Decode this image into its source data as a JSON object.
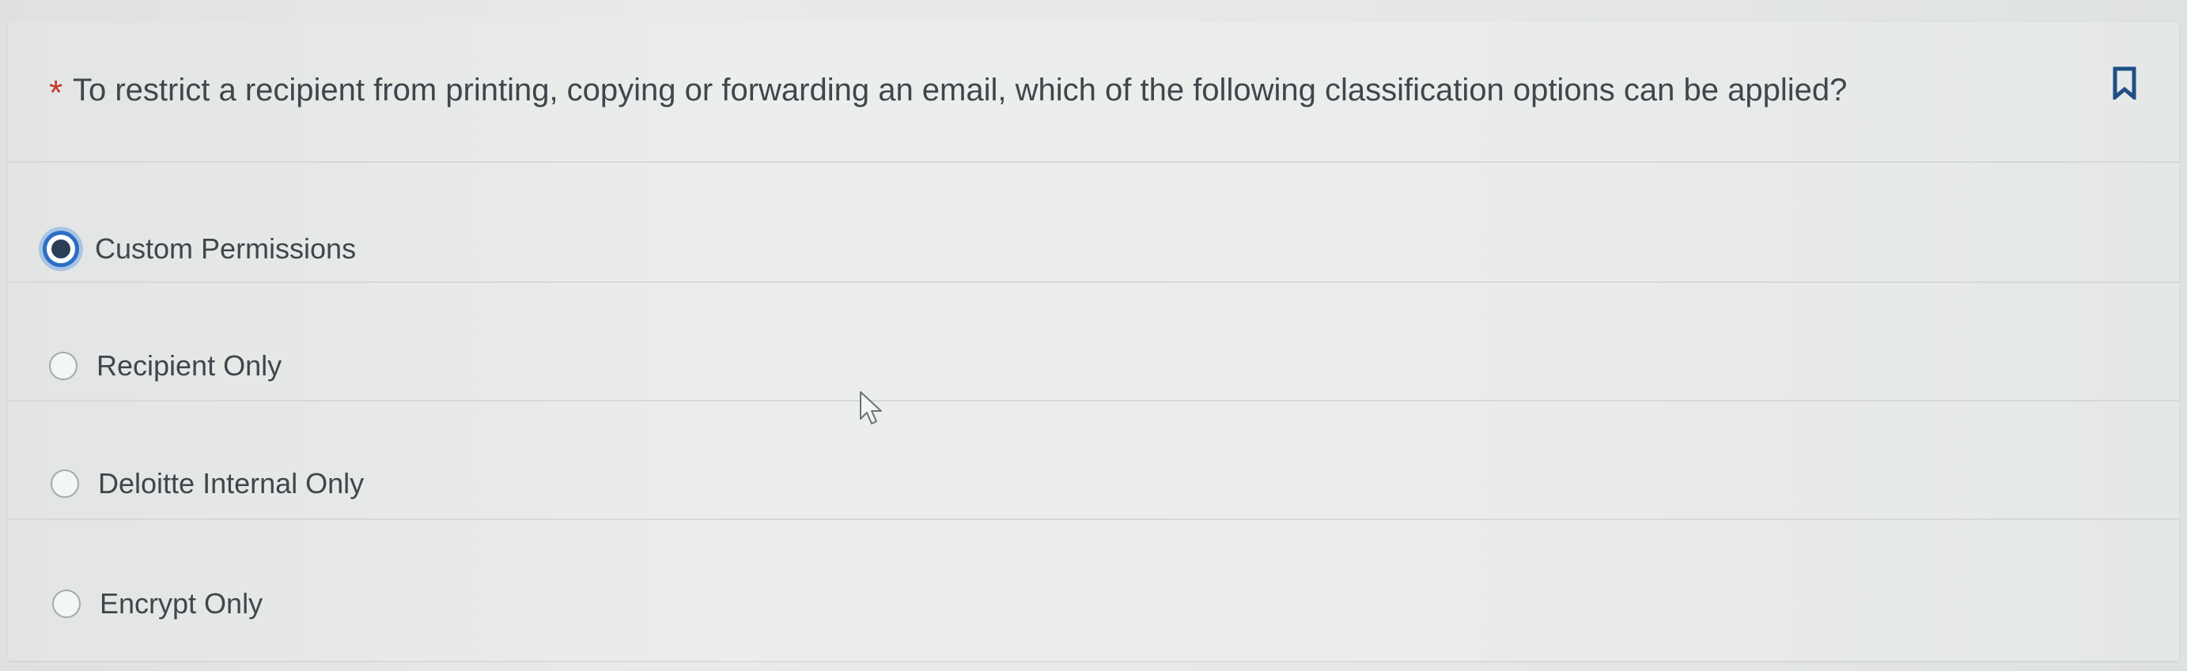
{
  "question": {
    "required_marker": "*",
    "text": "To restrict a recipient from printing, copying or forwarding an email, which of the following classification options can be applied?",
    "bookmark_icon": "bookmark-icon"
  },
  "options": [
    {
      "label": "Custom Permissions",
      "selected": true
    },
    {
      "label": "Recipient Only",
      "selected": false
    },
    {
      "label": "Deloitte Internal Only",
      "selected": false
    },
    {
      "label": "Encrypt Only",
      "selected": false
    }
  ],
  "colors": {
    "required": "#c0392b",
    "radio_selected": "#2c6ec4",
    "text": "#3f464c"
  }
}
